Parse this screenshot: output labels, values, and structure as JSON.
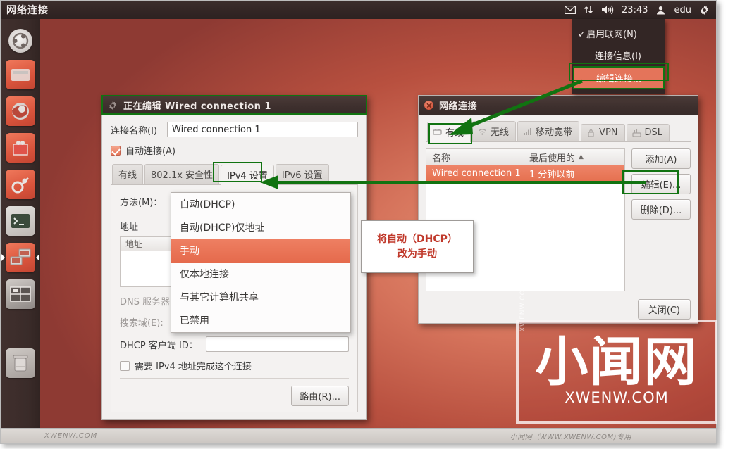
{
  "panel": {
    "title": "网络连接",
    "clock": "23:43",
    "user": "edu",
    "icons": [
      "mail-icon",
      "network-icon",
      "volume-icon",
      "user-icon",
      "gear-icon"
    ]
  },
  "launcher": {
    "items": [
      {
        "name": "ubuntu-dash",
        "label": "Ubuntu"
      },
      {
        "name": "files",
        "label": "文件管理器"
      },
      {
        "name": "firefox",
        "label": "Firefox"
      },
      {
        "name": "software-center",
        "label": "Ubuntu 软件中心"
      },
      {
        "name": "system-settings",
        "label": "系统设置"
      },
      {
        "name": "terminal",
        "label": "终端"
      },
      {
        "name": "remote-desktop",
        "label": "远程桌面"
      },
      {
        "name": "workspace-switcher",
        "label": "工作区切换器"
      },
      {
        "name": "trash",
        "label": "回收站"
      }
    ]
  },
  "net_menu": {
    "enable_networking": "启用联网(N)",
    "connection_info": "连接信息(I)",
    "edit_connections": "编辑连接...",
    "checked": "✓"
  },
  "edit_window": {
    "title": "正在编辑 Wired connection 1",
    "connection_name_label": "连接名称(I)",
    "connection_name_value": "Wired connection 1",
    "autoconnect_label": "自动连接(A)",
    "autoconnect_checked": true,
    "tabs": [
      {
        "label": "有线",
        "active": false
      },
      {
        "label": "802.1x 安全性",
        "active": false
      },
      {
        "label": "IPv4 设置",
        "active": true
      },
      {
        "label": "IPv6 设置",
        "active": false
      }
    ],
    "method_label": "方法(M)：",
    "address_label": "地址",
    "address_column": "地址",
    "dns_label": "DNS 服务器",
    "search_domain_label": "搜索域(E):",
    "dhcp_client_id_label": "DHCP 客户端 ID：",
    "dhcp_client_id_value": "",
    "require_ipv4_label": "需要 IPv4 地址完成这个连接",
    "require_ipv4_checked": false,
    "routes_button": "路由(R)..."
  },
  "method_menu": {
    "options": [
      {
        "label": "自动(DHCP)",
        "selected": false
      },
      {
        "label": "自动(DHCP)仅地址",
        "selected": false
      },
      {
        "label": "手动",
        "selected": true
      },
      {
        "label": "仅本地连接",
        "selected": false
      },
      {
        "label": "与其它计算机共享",
        "selected": false
      },
      {
        "label": "已禁用",
        "selected": false
      }
    ]
  },
  "net_window": {
    "title": "网络连接",
    "tabs": [
      {
        "label": "有线",
        "icon": "wired-icon",
        "active": true
      },
      {
        "label": "无线",
        "icon": "wireless-icon",
        "active": false
      },
      {
        "label": "移动宽带",
        "icon": "mobile-icon",
        "active": false
      },
      {
        "label": "VPN",
        "icon": "vpn-icon",
        "active": false
      },
      {
        "label": "DSL",
        "icon": "dsl-icon",
        "active": false
      }
    ],
    "columns": {
      "name": "名称",
      "last_used": "最后使用的",
      "sort_arrow": "▲"
    },
    "rows": [
      {
        "name": "Wired connection 1",
        "last_used": "1 分钟以前",
        "selected": true
      }
    ],
    "buttons": {
      "add": "添加(A)",
      "edit": "编辑(E)...",
      "delete": "删除(D)...",
      "close": "关闭(C)"
    }
  },
  "annotation": {
    "callout_line1": "将自动（DHCP）",
    "callout_line2": "改为手动",
    "highlight_color": "#117311",
    "callout_text_color": "#c0392b"
  },
  "watermark": {
    "big": "小闻网",
    "small": "XWENW.COM",
    "side": "XWENW.COM",
    "bottom_left": "XWENW.COM",
    "bottom_right": "小闻网（WWW.XWENW.COM)专用"
  }
}
